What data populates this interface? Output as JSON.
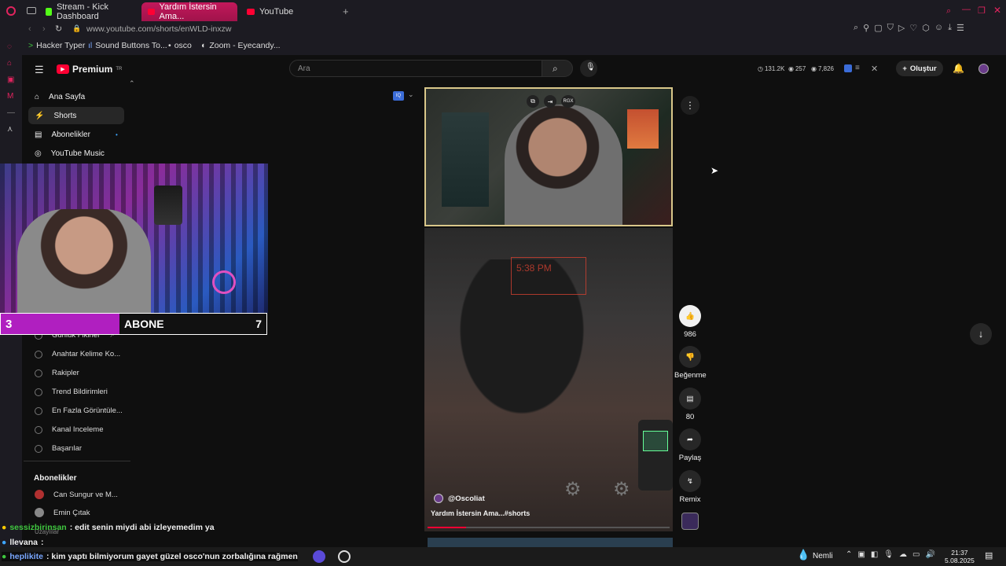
{
  "browser": {
    "tabs": [
      {
        "label": "Stream - Kick Dashboard",
        "icon": "kick-icon"
      },
      {
        "label": "Yardım İstersin Ama...",
        "icon": "youtube-icon",
        "active": true
      },
      {
        "label": "YouTube",
        "icon": "youtube-icon"
      }
    ],
    "url": "www.youtube.com/shorts/enWLD-inxzw",
    "bookmarks": [
      "Hacker Typer",
      "Sound Buttons To...",
      "osco",
      "Zoom - Eyecandy..."
    ]
  },
  "youtube": {
    "logo_text": "Premium",
    "logo_sup": "TR",
    "search_placeholder": "Ara",
    "stats": {
      "views": "131.2K",
      "b": "257",
      "c": "7,826"
    },
    "create_label": "Oluştur",
    "nav": [
      "Ana Sayfa",
      "Shorts",
      "Abonelikler",
      "YouTube Music"
    ],
    "studio_items": [
      "Günlük Fikirler",
      "Anahtar Kelime Ko...",
      "Rakipler",
      "Trend Bildirimleri",
      "En Fazla Görüntüle...",
      "Kanal Inceleme",
      "Başarılar"
    ],
    "subs_heading": "Abonelikler",
    "subs": [
      "Can Sungur ve M...",
      "Emin Çıtak",
      "Uzaylılar"
    ]
  },
  "short": {
    "channel": "@Oscoliat",
    "title": "Yardım İstersin Ama...",
    "hashtag": "#shorts",
    "clock_text": "5:38 PM",
    "rgx_label": "RGX",
    "actions": {
      "likes": "986",
      "dislike_label": "Beğenme",
      "comments": "80",
      "share_label": "Paylaş",
      "remix_label": "Remix"
    }
  },
  "overlay": {
    "sub_count_left": "3",
    "sub_label": "ABONE",
    "sub_count_right": "7"
  },
  "chat": [
    {
      "user": "sessizbirinsan",
      "text": ": edit senin miydi abi izleyemedim ya",
      "color": "#3fc73f"
    },
    {
      "user": "llevana",
      "text": ":",
      "color": "#ffffff"
    },
    {
      "user": "heplikite",
      "text": ": kim yaptı bilmiyorum gayet güzel osco'nun zorbalığına rağmen",
      "color": "#7aa8ff"
    }
  ],
  "taskbar": {
    "weather": "Nemli",
    "time": "21:37",
    "date": "5.08.2025"
  }
}
